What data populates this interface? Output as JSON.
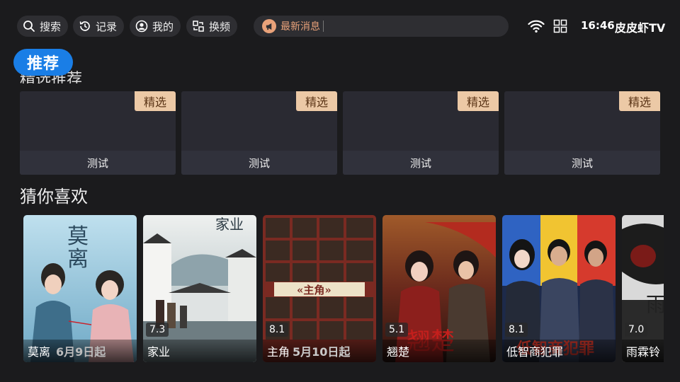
{
  "topbar": {
    "search_label": "搜索",
    "history_label": "记录",
    "mine_label": "我的",
    "channel_label": "换频",
    "news_label": "最新消息",
    "time": "16:46",
    "brand": "皮皮虾TV",
    "icons": [
      "search-icon",
      "history-icon",
      "user-icon",
      "switch-icon",
      "megaphone-icon",
      "wifi-icon",
      "apps-grid-icon"
    ]
  },
  "nav": {
    "recommend_tag": "推荐",
    "section_partial": "精选推荐"
  },
  "featured": {
    "badge_color": "#ecc9a6",
    "items": [
      {
        "badge": "精选",
        "label": "测试"
      },
      {
        "badge": "精选",
        "label": "测试"
      },
      {
        "badge": "精选",
        "label": "测试"
      },
      {
        "badge": "精选",
        "label": "测试"
      }
    ]
  },
  "guess": {
    "title": "猜你喜欢",
    "items": [
      {
        "title": "莫离",
        "score": "",
        "caption": "6月9日起"
      },
      {
        "title": "家业",
        "score": "7.3",
        "caption": ""
      },
      {
        "title": "主角",
        "score": "8.1",
        "caption": "5月10日起"
      },
      {
        "title": "翘楚",
        "score": "5.1",
        "caption": ""
      },
      {
        "title": "低智商犯罪",
        "score": "8.1",
        "caption": ""
      },
      {
        "title": "雨霖铃",
        "score": "7.0",
        "caption": ""
      }
    ]
  },
  "colors": {
    "accent": "#1a7ee6",
    "background": "#1b1b1d",
    "news": "#e9a27a"
  }
}
